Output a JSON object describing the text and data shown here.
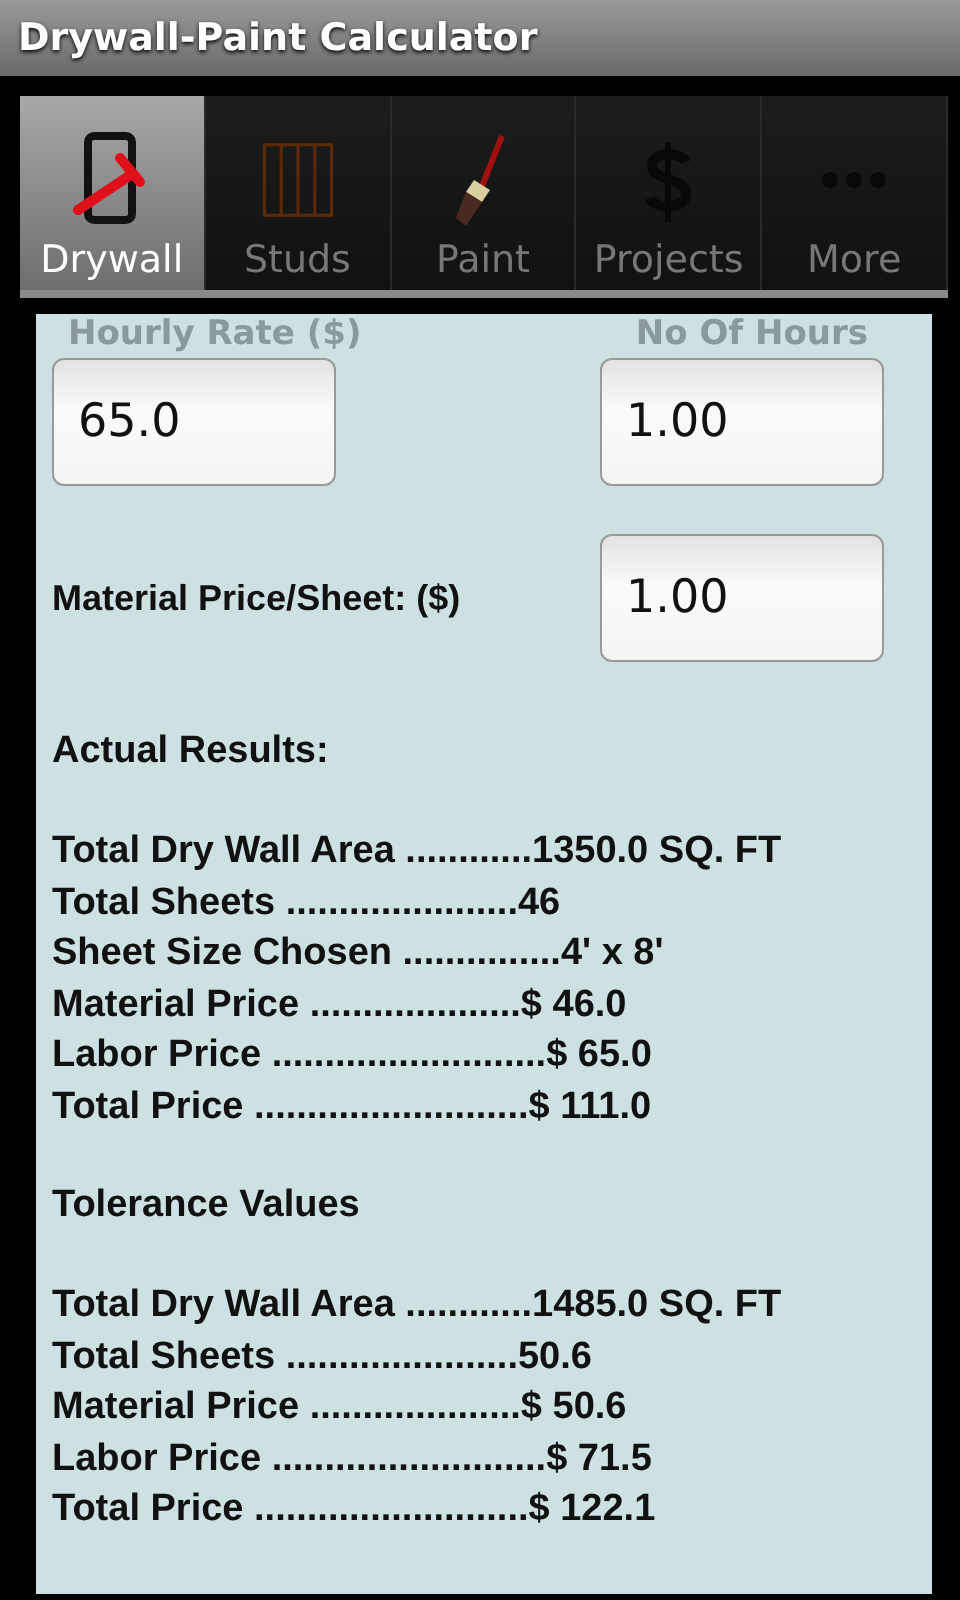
{
  "window": {
    "title": "Drywall-Paint Calculator"
  },
  "tabs": [
    {
      "label": "Drywall",
      "selected": true
    },
    {
      "label": "Studs",
      "selected": false
    },
    {
      "label": "Paint",
      "selected": false
    },
    {
      "label": "Projects",
      "selected": false
    },
    {
      "label": "More",
      "selected": false
    }
  ],
  "labor": {
    "rate_label": "Hourly Rate ($)",
    "rate_value": "65.0",
    "hours_label": "No Of Hours",
    "hours_value": "1.00"
  },
  "material": {
    "label": "Material Price/Sheet: ($)",
    "value": "1.00"
  },
  "actual_results": {
    "heading": "Actual Results:",
    "lines": [
      "Total Dry Wall Area ............1350.0 SQ. FT",
      "Total Sheets ......................46",
      "Sheet Size Chosen ...............4' x 8'",
      "Material Price ....................$ 46.0",
      "Labor Price ..........................$ 65.0",
      "Total Price ..........................$ 111.0"
    ]
  },
  "tolerance_values": {
    "heading": "Tolerance Values",
    "lines": [
      "Total Dry Wall Area ............1485.0 SQ. FT",
      "Total Sheets ......................50.6",
      "Material Price ....................$ 50.6",
      "Labor Price ..........................$ 71.5",
      "Total Price ..........................$ 122.1"
    ]
  }
}
